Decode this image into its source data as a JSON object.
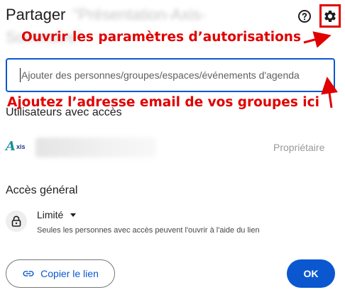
{
  "dialog": {
    "title": "Partager",
    "file_name_line1": "\"Présentation-Axis-",
    "file_name_line2": "Sommaire\""
  },
  "header": {
    "help_icon": "help-circle-icon",
    "settings_icon": "gear-icon"
  },
  "annotations": {
    "settings_hint": "Ouvrir les paramètres d’autorisations",
    "input_hint": "Ajoutez l’adresse email de vos groupes ici",
    "color": "#e00000"
  },
  "share_input": {
    "placeholder": "Ajouter des personnes/groupes/espaces/événements d'agenda"
  },
  "users_section": {
    "label": "Utilisateurs avec accès",
    "users": [
      {
        "logo_text_main": "A",
        "logo_text_rest": "xis",
        "role": "Propriétaire"
      }
    ]
  },
  "general_access": {
    "label": "Accès général",
    "icon": "lock-icon",
    "selected": "Limité",
    "description": "Seules les personnes avec accès peuvent l'ouvrir à l'aide du lien"
  },
  "footer": {
    "copy_link_label": "Copier le lien",
    "copy_link_icon": "link-icon",
    "ok_label": "OK"
  },
  "colors": {
    "primary": "#0b57d0",
    "annotation": "#e00000"
  }
}
